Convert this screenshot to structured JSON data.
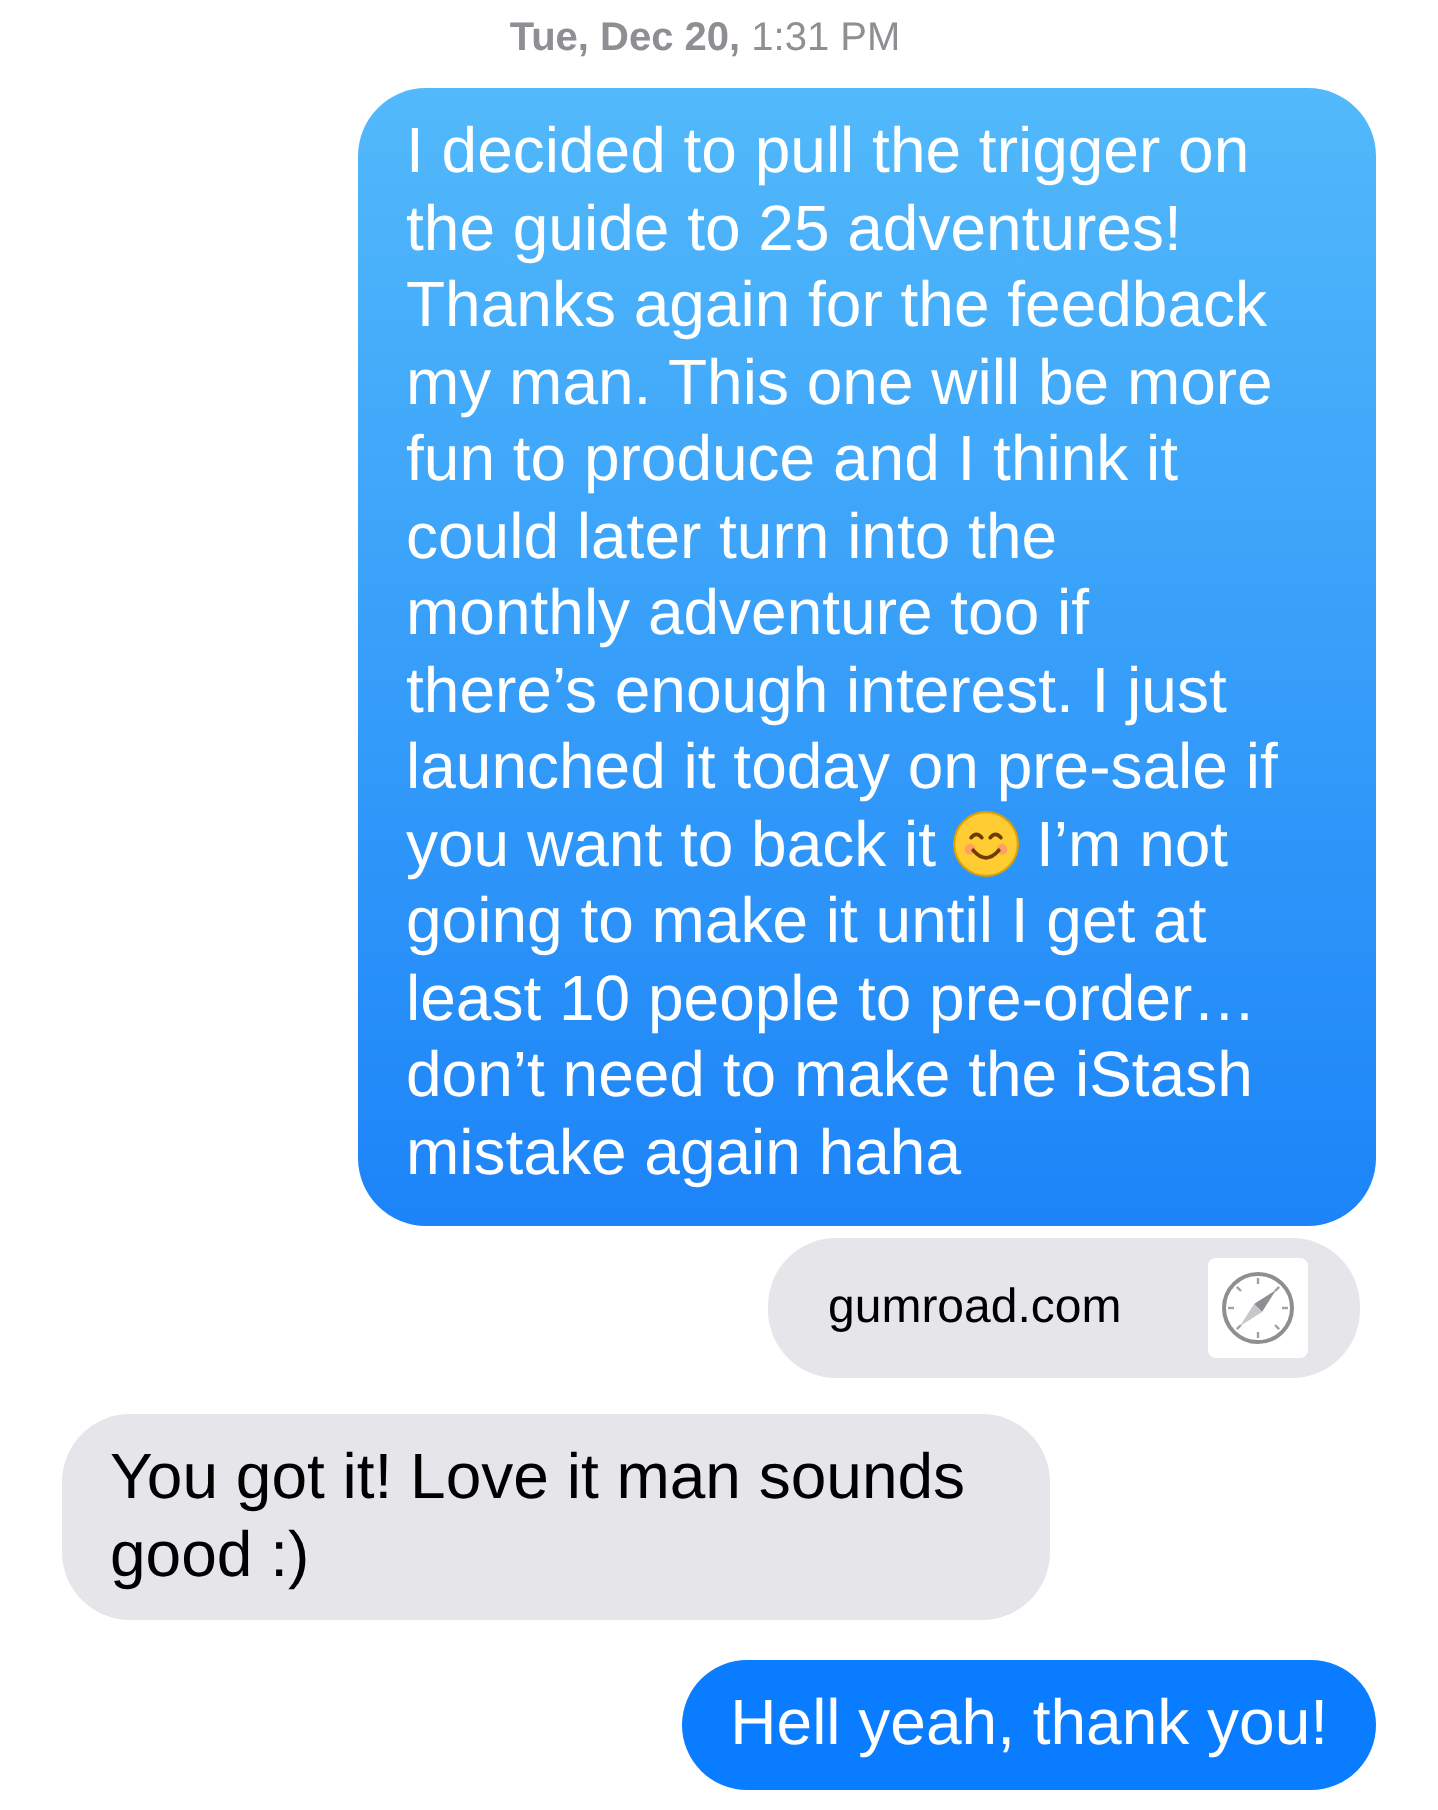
{
  "timestamp": "**Tue, Dec 20,** 1:31 PM",
  "messages": [
    {
      "kind": "text",
      "outgoing": true,
      "text_before": "I decided to pull the trigger on the guide to 25 adventures! Thanks again for the feedback my man. This one will be more fun to produce and I think it could later turn into the monthly adventure too if there’s enough interest. I just launched it today on pre-sale if you want to back it",
      "text_after": "I’m not going to make it until I get at least 10 people to pre-order… don’t need to make the iStash mistake again haha"
    },
    {
      "kind": "link",
      "outgoing": true,
      "text": "gumroad.com"
    },
    {
      "kind": "text",
      "outgoing": false,
      "text_before": "You got it! Love it man sounds good :)"
    },
    {
      "kind": "text",
      "outgoing": true,
      "text_before": "Hell yeah, thank you!"
    }
  ]
}
